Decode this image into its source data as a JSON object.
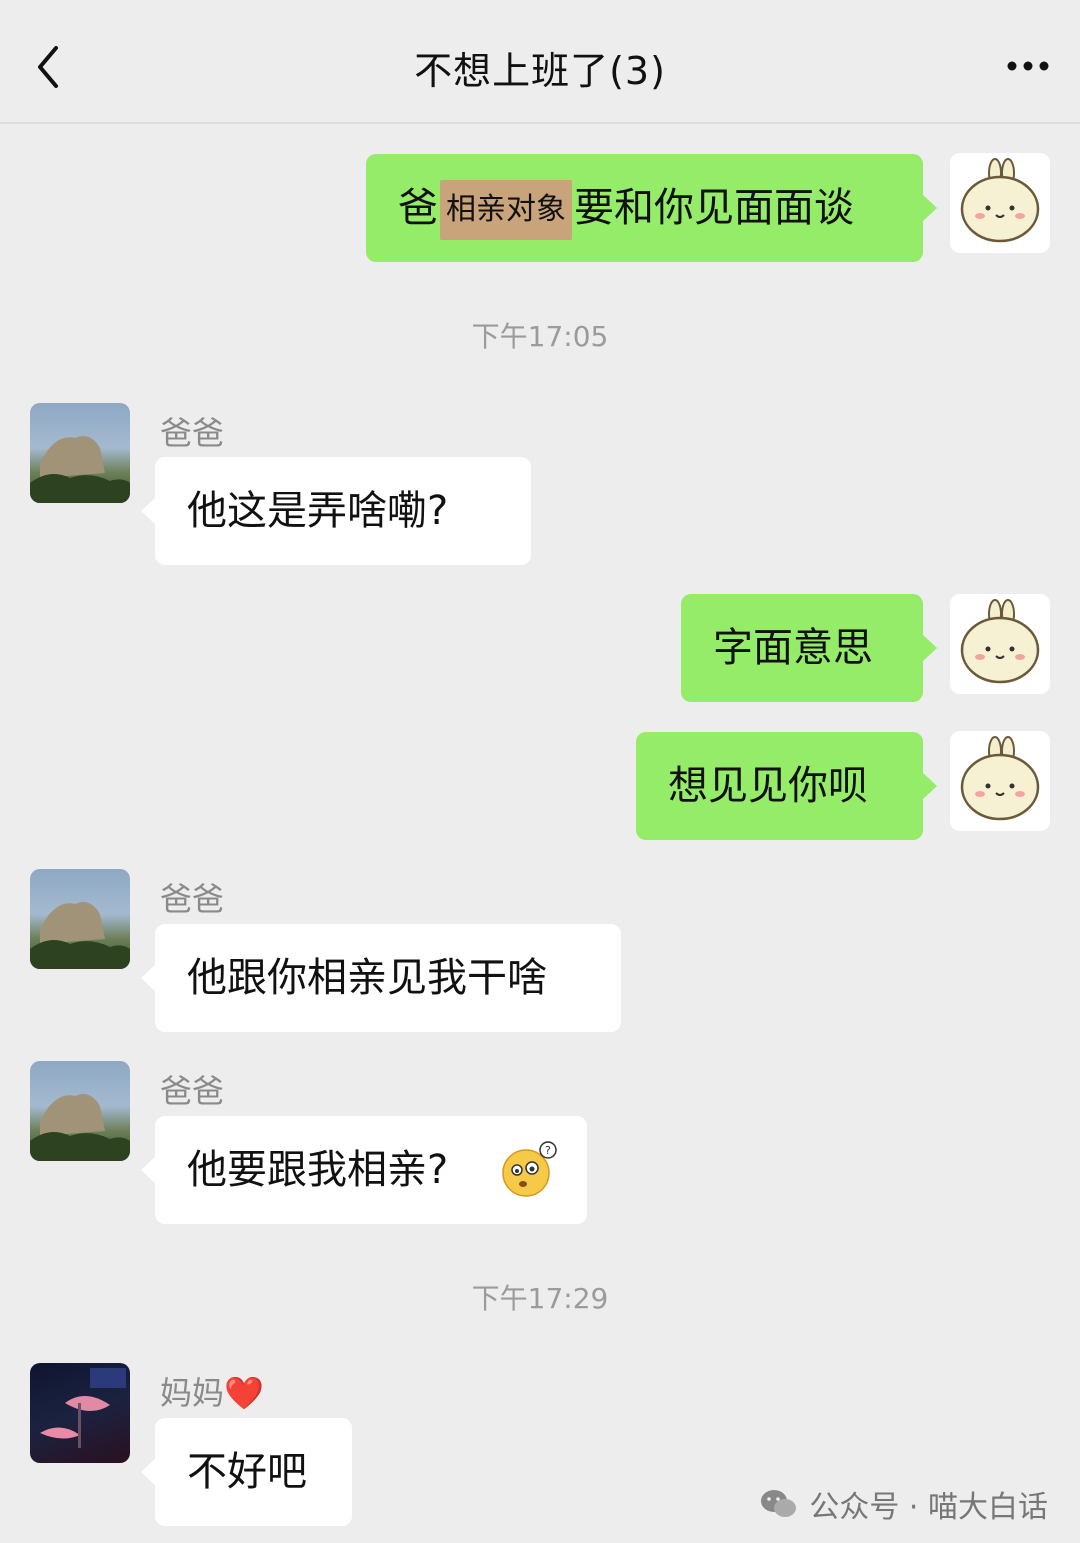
{
  "header": {
    "title": "不想上班了(3)",
    "more": "•••"
  },
  "messages": {
    "m1": {
      "prefix": "爸",
      "redacted": "相亲对象",
      "suffix": "要和你见面面谈"
    },
    "time1": "下午17:05",
    "m2": {
      "sender": "爸爸",
      "text": "他这是弄啥嘞?"
    },
    "m3": {
      "text": "字面意思"
    },
    "m4": {
      "text": "想见见你呗"
    },
    "m5": {
      "sender": "爸爸",
      "text": "他跟你相亲见我干啥"
    },
    "m6": {
      "sender": "爸爸",
      "text": "他要跟我相亲?",
      "emoji": "confused-face-emoji"
    },
    "time2": "下午17:29",
    "m7": {
      "sender": "妈妈",
      "sender_emoji": "❤️",
      "text": "不好吧"
    }
  },
  "watermark": {
    "text": "公众号 · 喵大白话",
    "icon": "wechat-icon"
  },
  "colors": {
    "sent_bubble": "#95ec69",
    "recv_bubble": "#ffffff",
    "background": "#ededed"
  }
}
